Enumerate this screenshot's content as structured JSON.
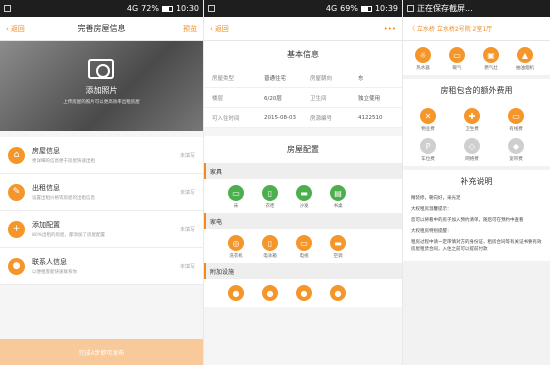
{
  "panel1": {
    "status": {
      "net": "4G",
      "battery": "72%",
      "time": "10:30",
      "battery_level": 0.72
    },
    "back": "返回",
    "title": "完善房屋信息",
    "right": "预览",
    "photo": {
      "label": "添加照片",
      "hint": "上传房屋的照片可以更高效率出租房屋"
    },
    "items": [
      {
        "icon": "⌂",
        "title": "房屋信息",
        "desc": "更详细的信息便于房屋快速出租",
        "status": "未填写"
      },
      {
        "icon": "✎",
        "title": "出租信息",
        "desc": "设置出租价格等房屋的出租信息",
        "status": "未填写"
      },
      {
        "icon": "+",
        "title": "添加配置",
        "desc": "80%出租的房屋，都添加了房屋配置",
        "status": "未填写"
      },
      {
        "icon": "●",
        "title": "联系人信息",
        "desc": "以便租客能快速联系你",
        "status": "未填写"
      }
    ],
    "submit": "完成4步即可发布"
  },
  "panel2": {
    "status": {
      "net": "4G",
      "battery": "69%",
      "time": "10:39",
      "battery_level": 0.69
    },
    "back": "返回",
    "more": "•••",
    "basic_title": "基本信息",
    "rows": [
      [
        "房屋类型",
        "普通住宅",
        "房屋朝向",
        "东"
      ],
      [
        "楼层",
        "6/20层",
        "卫生间",
        "独立使用"
      ],
      [
        "可入住时间",
        "2015-08-03",
        "房源编号",
        "4122510"
      ]
    ],
    "config_title": "房屋配置",
    "cats": [
      {
        "name": "家具",
        "items": [
          {
            "i": "▭",
            "l": "床",
            "g": true
          },
          {
            "i": "▯",
            "l": "衣柜",
            "g": true
          },
          {
            "i": "▬",
            "l": "沙发",
            "g": true
          },
          {
            "i": "▤",
            "l": "书桌",
            "g": true
          }
        ]
      },
      {
        "name": "家电",
        "items": [
          {
            "i": "◎",
            "l": "洗衣机",
            "g": false
          },
          {
            "i": "▯",
            "l": "电冰箱",
            "g": false
          },
          {
            "i": "▭",
            "l": "电视",
            "g": false
          },
          {
            "i": "▬",
            "l": "空调",
            "g": false
          }
        ]
      },
      {
        "name": "附加设施",
        "items": [
          {
            "i": "●",
            "l": "",
            "g": false
          },
          {
            "i": "●",
            "l": "",
            "g": false
          },
          {
            "i": "●",
            "l": "",
            "g": false
          },
          {
            "i": "●",
            "l": "",
            "g": false
          }
        ]
      }
    ]
  },
  "panel3": {
    "status": "正在保存截屏...",
    "nav": "〈 立水桥 立水桥2号院 2室1厅",
    "top_icons": [
      {
        "i": "☼",
        "l": "热水器"
      },
      {
        "i": "▭",
        "l": "暖气"
      },
      {
        "i": "▣",
        "l": "燃气灶"
      },
      {
        "i": "▲",
        "l": "抽油烟机"
      }
    ],
    "fee_title": "房租包含的额外费用",
    "fees": [
      {
        "i": "✕",
        "l": "物业费",
        "g": false
      },
      {
        "i": "✚",
        "l": "卫生费",
        "g": false
      },
      {
        "i": "▭",
        "l": "有线费",
        "g": false
      },
      {
        "i": "P",
        "l": "车位费",
        "g": true
      },
      {
        "i": "◇",
        "l": "网络费",
        "g": true
      },
      {
        "i": "◆",
        "l": "宽带费",
        "g": true
      }
    ],
    "notes_title": "补充说明",
    "notes": [
      "精装修，朝向好，采光足",
      "大权租房温馨提示：",
      "您可以将看中的房子加入预约清单，随后可在预约中查看",
      "大权租房特别提醒：",
      "租房过程中请一定审慎对方的身份证，租房合同等有关证书要有效房屋租赁合同，入住之前可以提前付款"
    ]
  }
}
